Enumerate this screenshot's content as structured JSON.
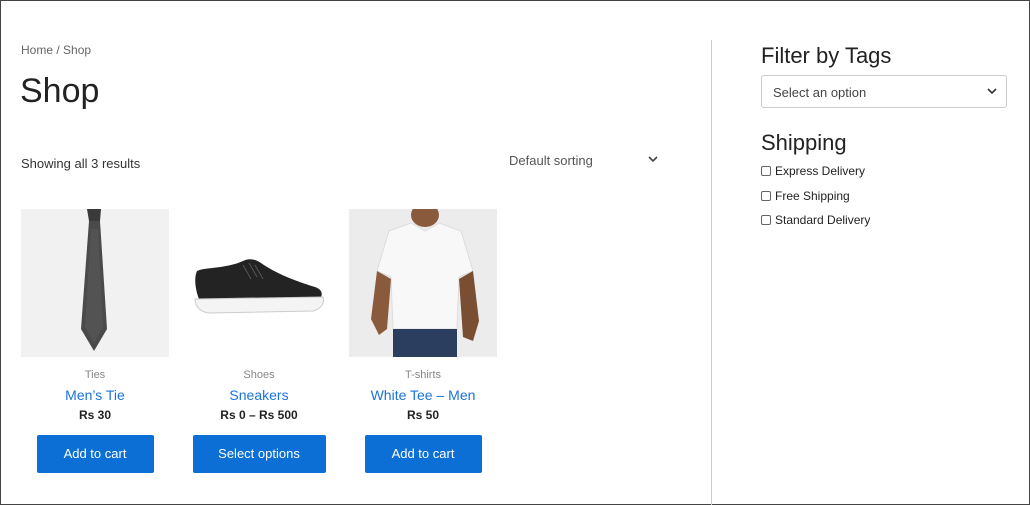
{
  "breadcrumb": {
    "home": "Home",
    "sep": "/",
    "current": "Shop"
  },
  "page_title": "Shop",
  "result_count": "Showing all 3 results",
  "sorting": {
    "selected": "Default sorting",
    "icon": "chevron-down-icon"
  },
  "products": [
    {
      "category": "Ties",
      "name": "Men’s Tie",
      "price": "Rs 30",
      "button": "Add to cart"
    },
    {
      "category": "Shoes",
      "name": "Sneakers",
      "price": "Rs 0 – Rs 500",
      "button": "Select options"
    },
    {
      "category": "T-shirts",
      "name": "White Tee – Men",
      "price": "Rs 50",
      "button": "Add to cart"
    }
  ],
  "sidebar": {
    "filter_heading": "Filter by Tags",
    "filter_select": "Select an option",
    "shipping_heading": "Shipping",
    "shipping_options": [
      "Express Delivery",
      "Free Shipping",
      "Standard Delivery"
    ]
  },
  "colors": {
    "accent": "#0b6fd6",
    "link": "#1a73d9"
  }
}
